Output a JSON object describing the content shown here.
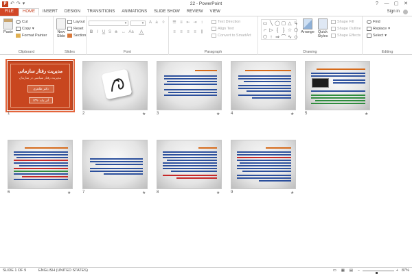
{
  "window": {
    "title": "22 - PowerPoint",
    "minimize": "—",
    "maximize": "▢",
    "close": "✕",
    "ribbon_options": "?"
  },
  "qat": [
    "↶",
    "↷",
    "▾"
  ],
  "tabs": {
    "file": "FILE",
    "items": [
      "HOME",
      "INSERT",
      "DESIGN",
      "TRANSITIONS",
      "ANIMATIONS",
      "SLIDE SHOW",
      "REVIEW",
      "VIEW"
    ],
    "active_index": 0
  },
  "account": {
    "signin": "Sign in"
  },
  "ribbon": {
    "clipboard": {
      "label": "Clipboard",
      "paste": "Paste",
      "cut": "Cut",
      "copy": "Copy",
      "format_painter": "Format Painter"
    },
    "slides": {
      "label": "Slides",
      "new_slide": "New",
      "new_slide2": "Slide",
      "layout": "Layout",
      "reset": "Reset",
      "section": "Section"
    },
    "font": {
      "label": "Font"
    },
    "paragraph": {
      "label": "Paragraph",
      "text_direction": "Text Direction",
      "align_text": "Align Text",
      "convert_smartart": "Convert to SmartArt"
    },
    "drawing": {
      "label": "Drawing",
      "arrange": "Arrange",
      "quick_styles": "Quick",
      "quick_styles2": "Styles",
      "shape_fill": "Shape Fill",
      "shape_outline": "Shape Outline",
      "shape_effects": "Shape Effects"
    },
    "editing": {
      "label": "Editing",
      "find": "Find",
      "replace": "Replace",
      "select": "Select"
    }
  },
  "shape_glyphs": [
    "▭",
    "╲",
    "◯",
    "▢",
    "△",
    "↳",
    "⌐",
    "▷",
    "{",
    "}",
    "☆",
    "⬠",
    "⬡",
    "↑",
    "⇒",
    "⌒",
    "∿",
    "◇"
  ],
  "slides": [
    {
      "number": "1",
      "title": "مدیریت رفتار سازمانی",
      "subtitle": "مدیریت رفتار سیاسی در سازمان",
      "author": "دکتر طاهری",
      "year": "آذر ماه ۱۳۹۰",
      "star": ""
    },
    {
      "number": "2",
      "star": "★"
    },
    {
      "number": "3",
      "star": "★"
    },
    {
      "number": "4",
      "star": "★"
    },
    {
      "number": "5",
      "star": "★"
    },
    {
      "number": "6",
      "star": "★"
    },
    {
      "number": "7",
      "star": "★"
    },
    {
      "number": "8",
      "star": "★"
    },
    {
      "number": "9",
      "star": "★"
    }
  ],
  "status": {
    "slide_info": "SLIDE 1 OF 9",
    "language": "ENGLISH (UNITED STATES)",
    "zoom": "87%",
    "zoom_level": 87
  },
  "colors": {
    "accent": "#d24726",
    "title_slide_bg": "#c8461f",
    "selection": "#e4653b"
  }
}
